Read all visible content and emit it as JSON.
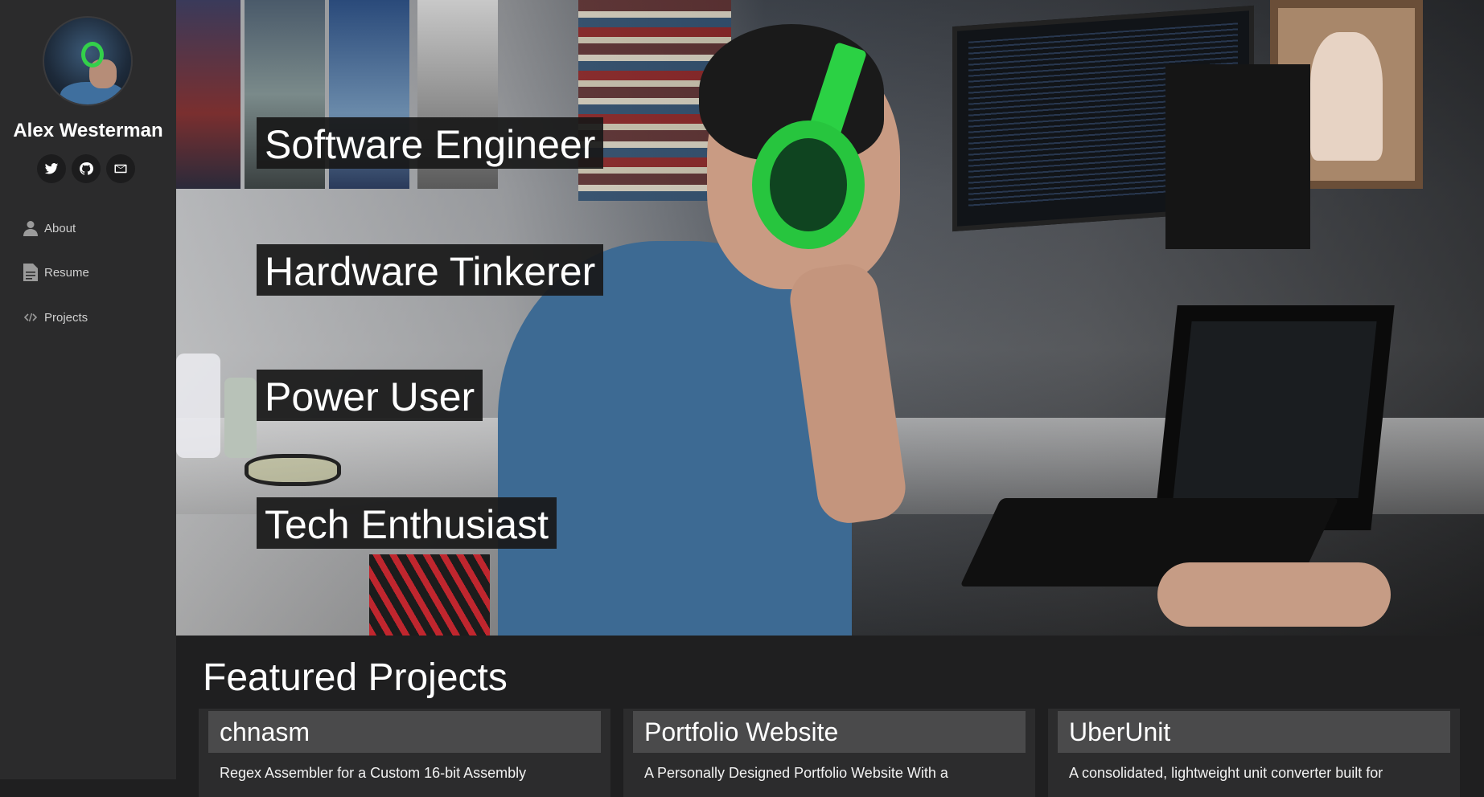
{
  "sidebar": {
    "name": "Alex Westerman",
    "social": [
      {
        "icon": "twitter-icon"
      },
      {
        "icon": "github-icon"
      },
      {
        "icon": "mail-icon"
      }
    ],
    "nav": [
      {
        "label": "About",
        "icon": "person-icon"
      },
      {
        "label": "Resume",
        "icon": "document-icon"
      },
      {
        "label": "Projects",
        "icon": "code-icon"
      }
    ]
  },
  "hero": {
    "taglines": [
      "Software Engineer",
      "Hardware Tinkerer",
      "Power User",
      "Tech Enthusiast"
    ]
  },
  "featured": {
    "title": "Featured Projects",
    "projects": [
      {
        "title": "chnasm",
        "description": "Regex Assembler for a Custom 16-bit Assembly"
      },
      {
        "title": "Portfolio Website",
        "description": "A Personally Designed Portfolio Website With a"
      },
      {
        "title": "UberUnit",
        "description": "A consolidated, lightweight unit converter built for"
      }
    ]
  },
  "colors": {
    "sidebar_bg": "#2b2b2c",
    "page_bg": "#1f1f20",
    "tag_bg": "#181818",
    "card_head_bg": "#4a4a4b",
    "accent_green": "#27c53e"
  }
}
